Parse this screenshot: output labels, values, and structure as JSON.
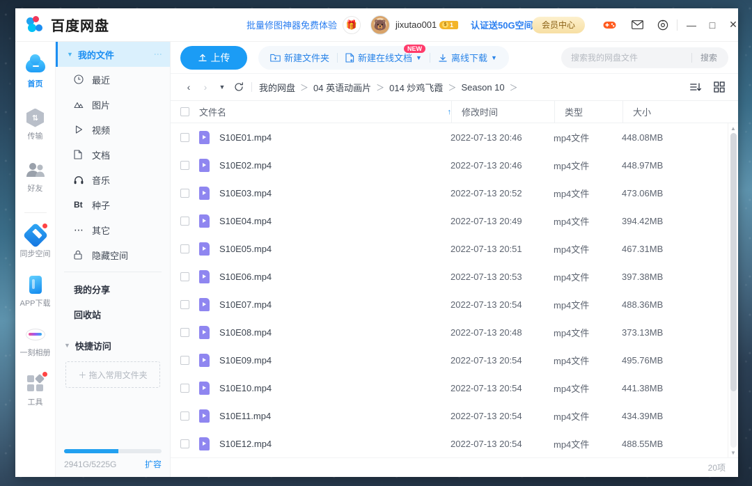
{
  "titlebar": {
    "brand_name": "百度网盘",
    "promo_text": "批量修图神器免费体验",
    "gift_icon": "gift-icon",
    "username": "jixutao001",
    "coin_count": "1",
    "cert_text": "认证送50G空间",
    "vip_label": "会员中心",
    "game_icon": "game-controller-icon",
    "mail_icon": "mail-icon",
    "gear_icon": "settings-icon",
    "minimize": "—",
    "maximize": "□",
    "close": "✕"
  },
  "rail": {
    "items": [
      {
        "label": "首页",
        "icon": "cloud-icon",
        "active": true,
        "dot": false
      },
      {
        "label": "传输",
        "icon": "transfer-icon",
        "active": false,
        "dot": false
      },
      {
        "label": "好友",
        "icon": "friends-icon",
        "active": false,
        "dot": false
      },
      {
        "label": "同步空间",
        "icon": "sync-space-icon",
        "active": false,
        "dot": true
      },
      {
        "label": "APP下载",
        "icon": "app-download-icon",
        "active": false,
        "dot": false
      },
      {
        "label": "一刻相册",
        "icon": "photo-album-icon",
        "active": false,
        "dot": false
      },
      {
        "label": "工具",
        "icon": "tools-icon",
        "active": false,
        "dot": true
      }
    ]
  },
  "tree": {
    "header_label": "我的文件",
    "header_caret": "▼",
    "more_icon": "more-options-icon",
    "categories": [
      {
        "label": "最近",
        "icon": "clock-icon",
        "glyph": "◷"
      },
      {
        "label": "图片",
        "icon": "image-icon",
        "glyph": "⛰"
      },
      {
        "label": "视频",
        "icon": "video-icon",
        "glyph": "▷"
      },
      {
        "label": "文档",
        "icon": "document-icon",
        "glyph": "🗋"
      },
      {
        "label": "音乐",
        "icon": "music-icon",
        "glyph": "🎧"
      },
      {
        "label": "种子",
        "icon": "torrent-icon",
        "glyph": "Bt"
      },
      {
        "label": "其它",
        "icon": "other-icon",
        "glyph": "⋯"
      },
      {
        "label": "隐藏空间",
        "icon": "lock-icon",
        "glyph": "🔒"
      }
    ],
    "plain_items": [
      {
        "label": "我的分享"
      },
      {
        "label": "回收站"
      }
    ],
    "quick_access": {
      "label": "快捷访问",
      "caret": "▼",
      "dropzone_text": "＋ 拖入常用文件夹"
    },
    "storage": {
      "caption": "2941G/5225G",
      "expand_label": "扩容",
      "used_percent": 56
    }
  },
  "toolbar": {
    "upload_label": "上传",
    "upload_icon": "upload-icon",
    "actions": [
      {
        "label": "新建文件夹",
        "icon": "new-folder-icon",
        "caret": "",
        "badge": ""
      },
      {
        "label": "新建在线文档",
        "icon": "new-doc-icon",
        "caret": "▼",
        "badge": "NEW"
      },
      {
        "label": "离线下载",
        "icon": "offline-download-icon",
        "caret": "▼",
        "badge": ""
      }
    ],
    "search_placeholder": "搜索我的网盘文件",
    "search_value": "",
    "search_button": "搜索",
    "search_icon": "search-icon"
  },
  "crumbbar": {
    "back_icon": "chevron-left-icon",
    "forward_icon": "chevron-right-icon",
    "history_icon": "chevron-down-icon",
    "refresh_icon": "refresh-icon",
    "crumbs": [
      "我的网盘",
      "04 英语动画片",
      "014 炒鸡飞霞",
      "Season 10"
    ],
    "separator": "＞",
    "trailing_separator": "＞",
    "sort_view_icon": "sort-list-icon",
    "grid_view_icon": "grid-view-icon"
  },
  "table": {
    "headers": {
      "name": "文件名",
      "sort_arrow": "↑",
      "time": "修改时间",
      "type": "类型",
      "size": "大小"
    },
    "rows": [
      {
        "name": "S10E01.mp4",
        "time": "2022-07-13 20:46",
        "type": "mp4文件",
        "size": "448.08MB",
        "icon": "video-file-icon"
      },
      {
        "name": "S10E02.mp4",
        "time": "2022-07-13 20:46",
        "type": "mp4文件",
        "size": "448.97MB",
        "icon": "video-file-icon"
      },
      {
        "name": "S10E03.mp4",
        "time": "2022-07-13 20:52",
        "type": "mp4文件",
        "size": "473.06MB",
        "icon": "video-file-icon"
      },
      {
        "name": "S10E04.mp4",
        "time": "2022-07-13 20:49",
        "type": "mp4文件",
        "size": "394.42MB",
        "icon": "video-file-icon"
      },
      {
        "name": "S10E05.mp4",
        "time": "2022-07-13 20:51",
        "type": "mp4文件",
        "size": "467.31MB",
        "icon": "video-file-icon"
      },
      {
        "name": "S10E06.mp4",
        "time": "2022-07-13 20:53",
        "type": "mp4文件",
        "size": "397.38MB",
        "icon": "video-file-icon"
      },
      {
        "name": "S10E07.mp4",
        "time": "2022-07-13 20:54",
        "type": "mp4文件",
        "size": "488.36MB",
        "icon": "video-file-icon"
      },
      {
        "name": "S10E08.mp4",
        "time": "2022-07-13 20:48",
        "type": "mp4文件",
        "size": "373.13MB",
        "icon": "video-file-icon"
      },
      {
        "name": "S10E09.mp4",
        "time": "2022-07-13 20:54",
        "type": "mp4文件",
        "size": "495.76MB",
        "icon": "video-file-icon"
      },
      {
        "name": "S10E10.mp4",
        "time": "2022-07-13 20:54",
        "type": "mp4文件",
        "size": "441.38MB",
        "icon": "video-file-icon"
      },
      {
        "name": "S10E11.mp4",
        "time": "2022-07-13 20:54",
        "type": "mp4文件",
        "size": "434.39MB",
        "icon": "video-file-icon"
      },
      {
        "name": "S10E12.mp4",
        "time": "2022-07-13 20:54",
        "type": "mp4文件",
        "size": "488.55MB",
        "icon": "video-file-icon"
      }
    ]
  },
  "statusbar": {
    "count_label": "20项"
  },
  "colors": {
    "accent": "#1b8ef2",
    "upload_blue": "#1b9cf5",
    "tree_active_bg": "#daf0fd",
    "file_icon": "#8f86f0",
    "vip_gold": "#f7dfa3",
    "badge_red": "#ff3b6b"
  }
}
